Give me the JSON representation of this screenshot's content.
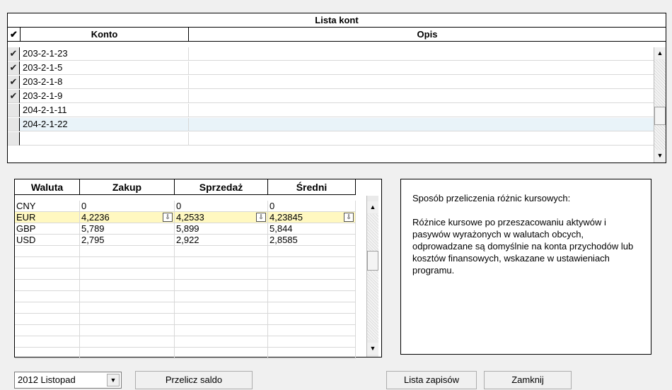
{
  "accounts_grid": {
    "title": "Lista kont",
    "check_header": "✔",
    "columns": [
      "Konto",
      "Opis"
    ],
    "rows": [
      {
        "checked": true,
        "konto": "203-2-1-23",
        "opis": ""
      },
      {
        "checked": true,
        "konto": "203-2-1-5",
        "opis": ""
      },
      {
        "checked": true,
        "konto": "203-2-1-8",
        "opis": ""
      },
      {
        "checked": true,
        "konto": "203-2-1-9",
        "opis": ""
      },
      {
        "checked": false,
        "konto": "204-2-1-11",
        "opis": ""
      },
      {
        "checked": false,
        "konto": "204-2-1-22",
        "opis": "",
        "selected": true
      },
      {
        "checked": false,
        "konto": "",
        "opis": ""
      }
    ]
  },
  "rates_grid": {
    "columns": [
      "Waluta",
      "Zakup",
      "Sprzedaż",
      "Średni"
    ],
    "rows": [
      {
        "waluta": "CNY",
        "zakup": "0",
        "sprzedaz": "0",
        "sredni": "0"
      },
      {
        "waluta": "EUR",
        "zakup": "4,2236",
        "sprzedaz": "4,2533",
        "sredni": "4,23845",
        "selected": true
      },
      {
        "waluta": "GBP",
        "zakup": "5,789",
        "sprzedaz": "5,899",
        "sredni": "5,844"
      },
      {
        "waluta": "USD",
        "zakup": "2,795",
        "sprzedaz": "2,922",
        "sredni": "2,8585"
      }
    ]
  },
  "info_panel": {
    "heading": "Sposób przeliczenia różnic kursowych:",
    "body": "Różnice kursowe po przeszacowaniu aktywów i pasywów wyrażonych w walutach obcych, odprowadzane są domyślnie na konta przychodów lub kosztów finansowych, wskazane w ustawieniach programu."
  },
  "footer": {
    "period_value": "2012 Listopad",
    "recalc_label": "Przelicz saldo",
    "entries_label": "Lista zapisów",
    "close_label": "Zamknij"
  },
  "colors": {
    "selected_row": "#e9f3f9",
    "eur_row": "#fff8c0"
  }
}
